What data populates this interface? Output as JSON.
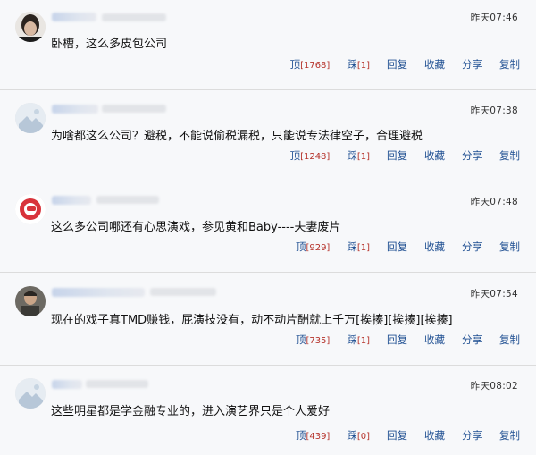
{
  "comments": [
    {
      "time": "昨天07:46",
      "text": "卧槽，这么多皮包公司",
      "actions": {
        "up_label": "顶",
        "up_count": "[1768]",
        "down_label": "踩",
        "down_count": "[1]",
        "reply": "回复",
        "fav": "收藏",
        "share": "分享",
        "copy": "复制"
      }
    },
    {
      "time": "昨天07:38",
      "text": "为啥都这么公司？避税，不能说偷税漏税，只能说专法律空子，合理避税",
      "actions": {
        "up_label": "顶",
        "up_count": "[1248]",
        "down_label": "踩",
        "down_count": "[1]",
        "reply": "回复",
        "fav": "收藏",
        "share": "分享",
        "copy": "复制"
      }
    },
    {
      "time": "昨天07:48",
      "text": "这么多公司哪还有心思演戏，参见黄和Baby----夫妻废片",
      "actions": {
        "up_label": "顶",
        "up_count": "[929]",
        "down_label": "踩",
        "down_count": "[1]",
        "reply": "回复",
        "fav": "收藏",
        "share": "分享",
        "copy": "复制"
      }
    },
    {
      "time": "昨天07:54",
      "text": "现在的戏子真TMD赚钱，屁演技没有，动不动片酬就上千万[挨揍][挨揍][挨揍]",
      "actions": {
        "up_label": "顶",
        "up_count": "[735]",
        "down_label": "踩",
        "down_count": "[1]",
        "reply": "回复",
        "fav": "收藏",
        "share": "分享",
        "copy": "复制"
      }
    },
    {
      "time": "昨天08:02",
      "text": "这些明星都是学金融专业的，进入演艺界只是个人爱好",
      "actions": {
        "up_label": "顶",
        "up_count": "[439]",
        "down_label": "踩",
        "down_count": "[0]",
        "reply": "回复",
        "fav": "收藏",
        "share": "分享",
        "copy": "复制"
      }
    }
  ]
}
